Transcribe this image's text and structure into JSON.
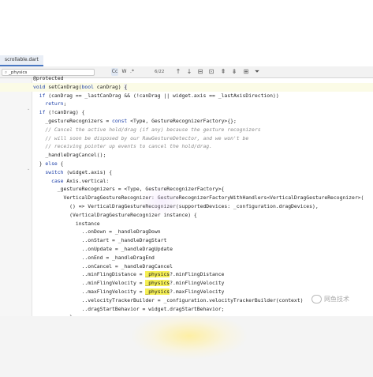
{
  "editor": {
    "tab_label": "scrollable.dart",
    "search_query": "_physics",
    "search_options": {
      "case": "Cc",
      "words": "W",
      "regex": ".*"
    },
    "match_count": "6/22",
    "toolbar_icons": [
      "arrow-up-icon",
      "arrow-down-icon",
      "filter-icon",
      "filter-in-selection-icon",
      "multi-cursor-add-icon",
      "multi-cursor-remove-icon",
      "select-all-occurrences-icon",
      "funnel-icon"
    ],
    "accent_color": "#4a78c2",
    "highlight_color": "#f5ef55"
  },
  "code_lines": [
    {
      "num": "",
      "text": "@protected"
    },
    {
      "num": "",
      "text": "void setCanDrag(bool canDrag) {"
    },
    {
      "num": "",
      "text": "  if (canDrag == _lastCanDrag && (!canDrag || widget.axis == _lastAxisDirection))"
    },
    {
      "num": "",
      "text": "    return;"
    },
    {
      "num": "",
      "text": "  if (!canDrag) {"
    },
    {
      "num": "",
      "text": "    _gestureRecognizers = const <Type, GestureRecognizerFactory>{};"
    },
    {
      "num": "",
      "text": "    // Cancel the active hold/drag (if any) because the gesture recognizers"
    },
    {
      "num": "",
      "text": "    // will soon be disposed by our RawGestureDetector, and we won't be"
    },
    {
      "num": "",
      "text": "    // receiving pointer up events to cancel the hold/drag."
    },
    {
      "num": "",
      "text": "    _handleDragCancel();"
    },
    {
      "num": "",
      "text": "  } else {"
    },
    {
      "num": "",
      "text": "    switch (widget.axis) {"
    },
    {
      "num": "",
      "text": "      case Axis.vertical:"
    },
    {
      "num": "",
      "text": "        _gestureRecognizers = <Type, GestureRecognizerFactory>{"
    },
    {
      "num": "",
      "text": "          VerticalDragGestureRecognizer: GestureRecognizerFactoryWithHandlers<VerticalDragGestureRecognizer>("
    },
    {
      "num": "",
      "text": "            () => VerticalDragGestureRecognizer(supportedDevices: _configuration.dragDevices),"
    },
    {
      "num": "",
      "text": "            (VerticalDragGestureRecognizer instance) {"
    },
    {
      "num": "",
      "text": "              instance"
    },
    {
      "num": "",
      "text": "                ..onDown = _handleDragDown"
    },
    {
      "num": "",
      "text": "                ..onStart = _handleDragStart"
    },
    {
      "num": "",
      "text": "                ..onUpdate = _handleDragUpdate"
    },
    {
      "num": "",
      "text": "                ..onEnd = _handleDragEnd"
    },
    {
      "num": "",
      "text": "                ..onCancel = _handleDragCancel"
    },
    {
      "num": "",
      "text": "                ..minFlingDistance = _physics?.minFlingDistance"
    },
    {
      "num": "",
      "text": "                ..minFlingVelocity = _physics?.minFlingVelocity"
    },
    {
      "num": "",
      "text": "                ..maxFlingVelocity = _physics?.maxFlingVelocity"
    },
    {
      "num": "",
      "text": "                ..velocityTrackerBuilder = _configuration.velocityTrackerBuilder(context)"
    },
    {
      "num": "",
      "text": "                ..dragStartBehavior = widget.dragStartBehavior;"
    },
    {
      "num": "",
      "text": "            },"
    }
  ],
  "watermark": "网鱼技术"
}
